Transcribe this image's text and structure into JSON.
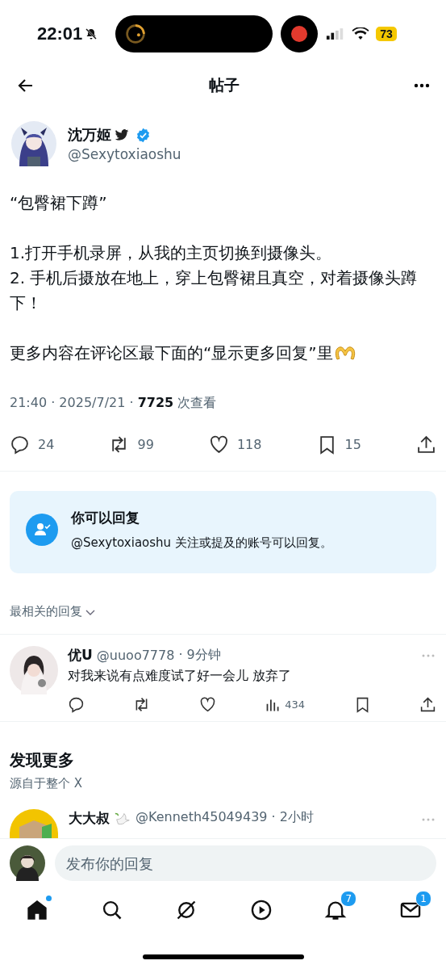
{
  "status_bar": {
    "time": "22:01",
    "battery": "73"
  },
  "header": {
    "title": "帖子"
  },
  "post": {
    "name": "沈万姬",
    "handle": "@Sexytoxiaoshu",
    "verified": true,
    "paragraphs": [
      "“包臀裙下蹲”",
      "1.打开手机录屏，从我的主页切换到摄像头。\n2. 手机后摄放在地上，穿上包臀裙且真空，对着摄像头蹲下！",
      "更多内容在评论区最下面的“显示更多回复”里"
    ],
    "meta": {
      "time": "21:40 · 2025/7/21 · ",
      "views": "7725",
      "views_label": " 次查看"
    },
    "actions": [
      {
        "kind": "reply",
        "count": "24"
      },
      {
        "kind": "repost",
        "count": "99"
      },
      {
        "kind": "like",
        "count": "118"
      },
      {
        "kind": "bookmark",
        "count": "15"
      },
      {
        "kind": "share"
      }
    ]
  },
  "reply_notice": {
    "title": "你可以回复",
    "text": "@Sexytoxiaoshu 关注或提及的账号可以回复。"
  },
  "sort": {
    "label": "最相关的回复"
  },
  "replies": [
    {
      "name": "优U",
      "handle": "@uuoo7778",
      "time": "· 9分钟",
      "text": "对我来说有点难度试了好一会儿 放弃了",
      "actions": [
        {
          "kind": "reply"
        },
        {
          "kind": "repost"
        },
        {
          "kind": "like"
        },
        {
          "kind": "views",
          "count": "434"
        },
        {
          "kind": "bookmark"
        },
        {
          "kind": "share"
        }
      ]
    }
  ],
  "discover": {
    "title": "发现更多",
    "subtitle": "源自于整个 X"
  },
  "suggested": {
    "name": "大大叔",
    "handle": "@Kenneth45049439",
    "time": "· 2小时"
  },
  "composer": {
    "placeholder": "发布你的回复"
  },
  "tabs": [
    {
      "kind": "home",
      "selected": true,
      "dot": true
    },
    {
      "kind": "search",
      "selected": false,
      "dot": false
    },
    {
      "kind": "grok",
      "selected": false,
      "dot": false
    },
    {
      "kind": "video",
      "selected": false,
      "dot": false
    },
    {
      "kind": "bell",
      "selected": false,
      "dot": false,
      "badge": "7"
    },
    {
      "kind": "mail",
      "selected": false,
      "dot": false,
      "badge": "1"
    }
  ]
}
